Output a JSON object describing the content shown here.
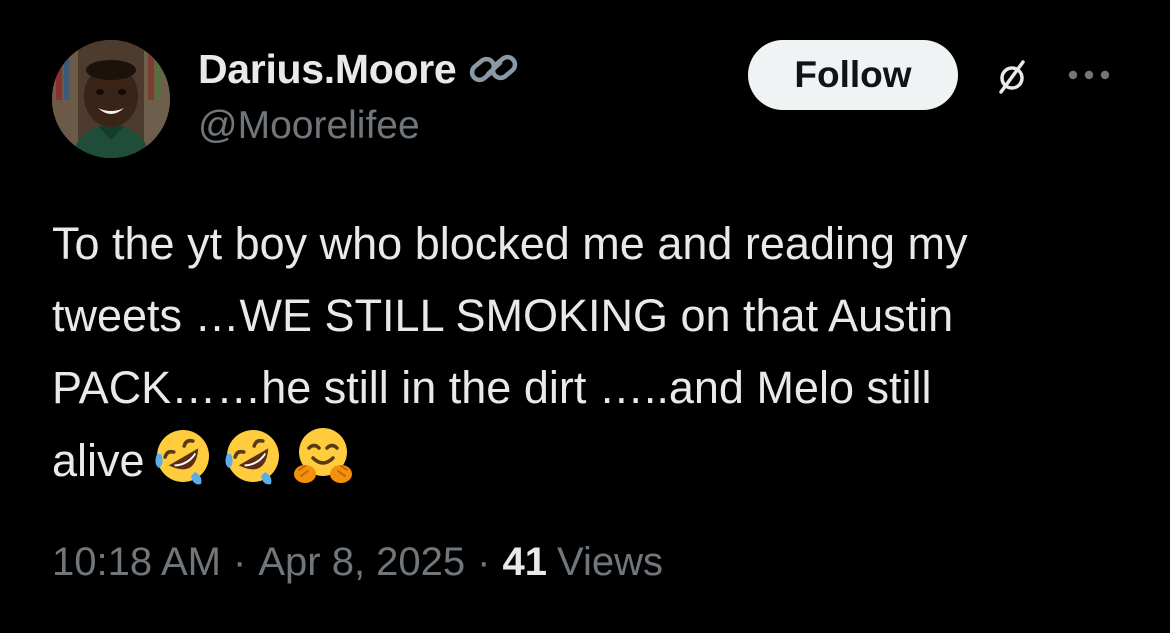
{
  "tweet": {
    "author": {
      "display_name": "Darius.Moore",
      "handle": "@Moorelifee",
      "badge_icon": "link-icon",
      "avatar_icon": "profile-photo"
    },
    "follow_label": "Follow",
    "actions": {
      "grok_icon": "grok-icon",
      "more_icon": "more-options-icon"
    },
    "text": "To the yt boy who blocked me and reading my\ntweets …WE STILL SMOKING on that Austin\nPACK……he still in the dirt …..and Melo still\nalive",
    "emojis": [
      "rolling-on-floor-laughing",
      "rolling-on-floor-laughing",
      "hugging-face"
    ],
    "time": "10:18 AM",
    "date": "Apr 8, 2025",
    "separator": "·",
    "views_count": "41",
    "views_label": "Views"
  },
  "colors": {
    "background": "#000000",
    "primary_text": "#e7e9ea",
    "secondary_text": "#71767b",
    "follow_bg": "#eff3f4",
    "follow_text": "#0f1419"
  }
}
